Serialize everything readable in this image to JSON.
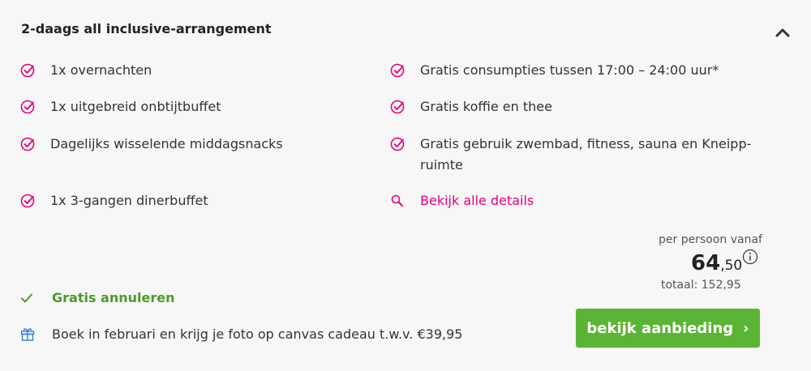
{
  "title": "2-daags all inclusive-arrangement",
  "features_left": [
    "1x overnachten",
    "1x uitgebreid onbtijtbuffet",
    "Dagelijks wisselende middagsnacks",
    "1x 3-gangen dinerbuffet"
  ],
  "features_right": [
    "Gratis consumpties tussen 17:00 – 24:00 uur*",
    "Gratis koffie en thee",
    "Gratis gebruik zwembad, fitness, sauna en Kneipp-ruimte"
  ],
  "details_link": "Bekijk alle details",
  "price": {
    "label": "per persoon vanaf",
    "whole": "64",
    "cents": ",50",
    "total": "totaal: 152,95"
  },
  "cancel_text": "Gratis annuleren",
  "promo_text": "Boek in februari en krijg je foto op canvas cadeau t.w.v. €39,95",
  "cta": {
    "label": "bekijk aanbieding",
    "chevron": "›"
  },
  "colors": {
    "accent": "#e6007e",
    "green": "#5bb534",
    "green_text": "#4c9a2a",
    "promo_icon": "#3a7bd5"
  },
  "icons": [
    "check-circle-icon",
    "search-icon",
    "check-icon",
    "gift-icon",
    "chevron-up-icon",
    "info-icon"
  ]
}
